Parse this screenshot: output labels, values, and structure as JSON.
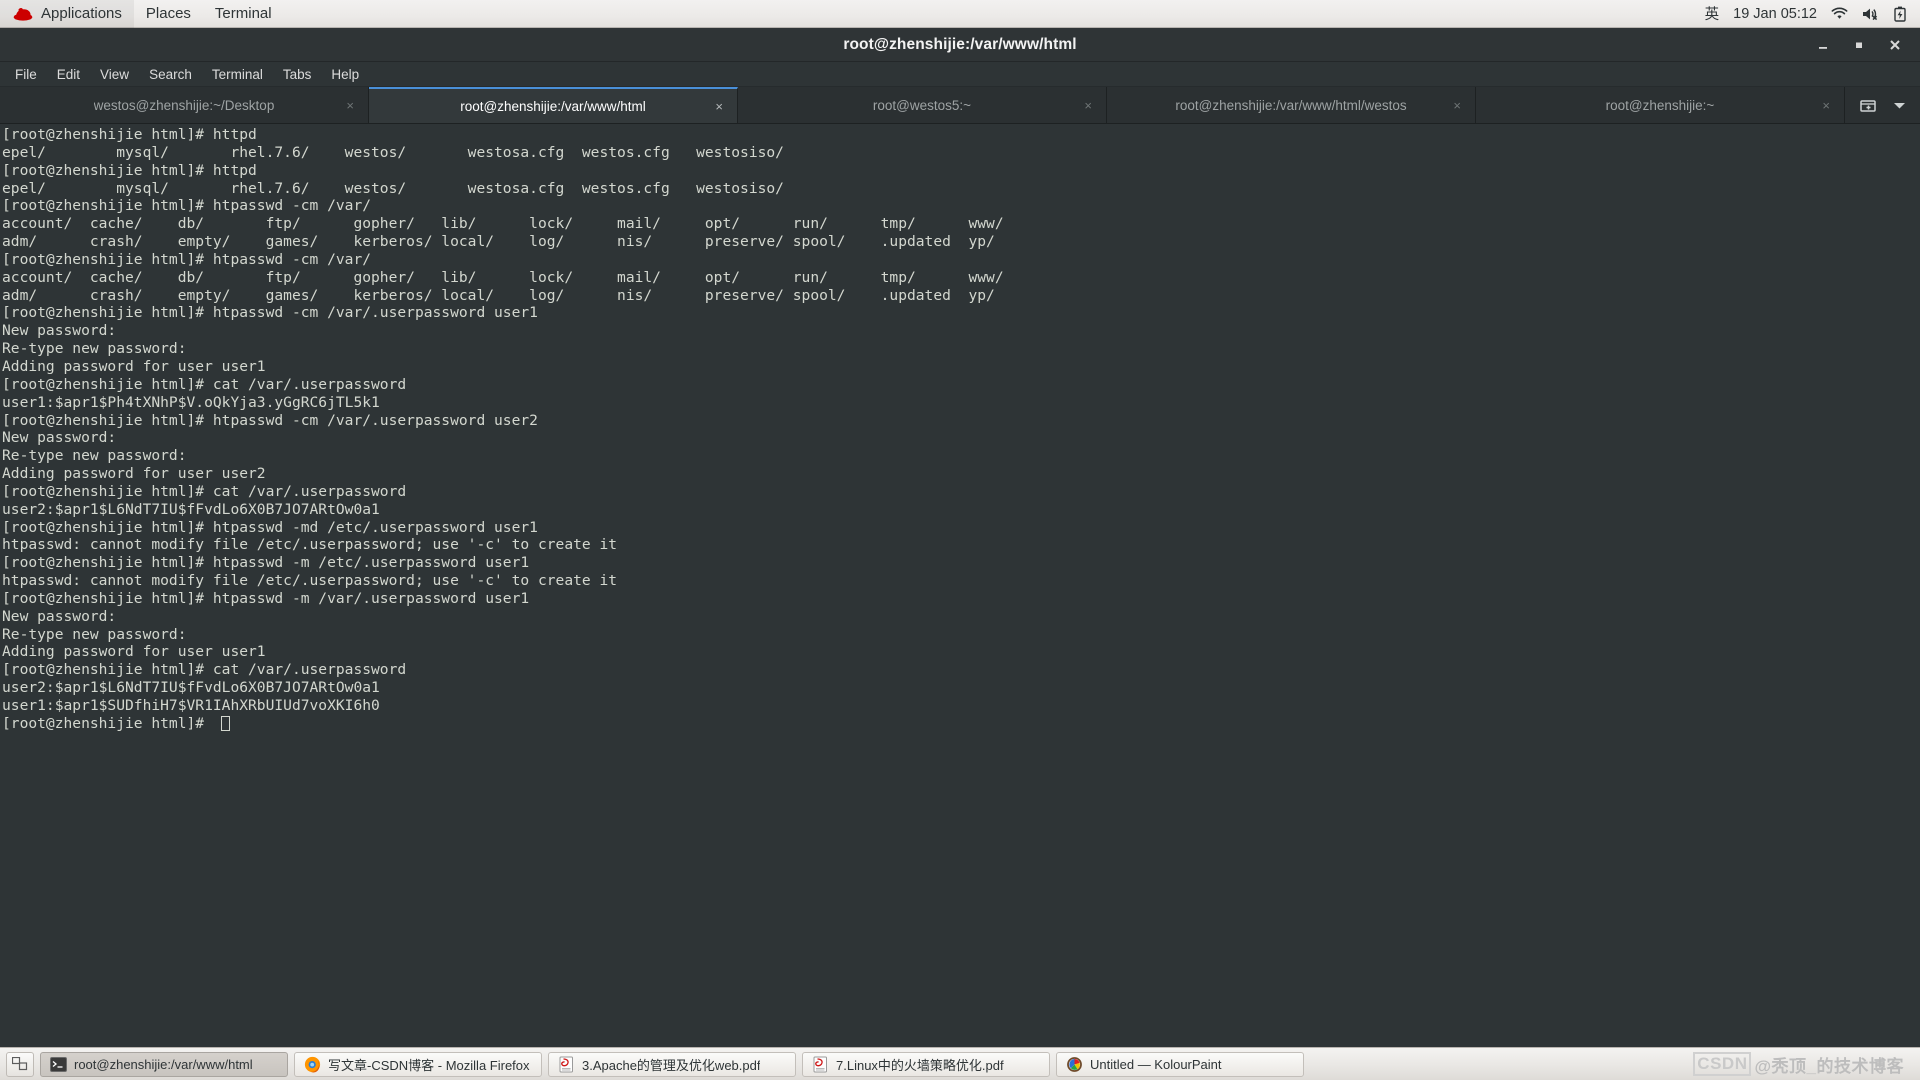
{
  "top_panel": {
    "logo_icon": "redhat-logo-icon",
    "menus": [
      "Applications",
      "Places",
      "Terminal"
    ],
    "input_method": "英",
    "clock": "19 Jan 05:12",
    "tray_icons": [
      "wifi-icon",
      "volume-muted-icon",
      "battery-charging-icon"
    ]
  },
  "window": {
    "title": "root@zhenshijie:/var/www/html",
    "controls": {
      "minimize": "minimize-button",
      "maximize": "maximize-button",
      "close": "close-button"
    }
  },
  "menubar": {
    "items": [
      "File",
      "Edit",
      "View",
      "Search",
      "Terminal",
      "Tabs",
      "Help"
    ]
  },
  "tabs": {
    "items": [
      {
        "label": "westos@zhenshijie:~/Desktop",
        "active": false
      },
      {
        "label": "root@zhenshijie:/var/www/html",
        "active": true
      },
      {
        "label": "root@westos5:~",
        "active": false
      },
      {
        "label": "root@zhenshijie:/var/www/html/westos",
        "active": false
      },
      {
        "label": "root@zhenshijie:~",
        "active": false
      }
    ],
    "close_glyph": "×",
    "new_tab_icon": "new-tab-icon",
    "tab_list_icon": "chevron-down-icon"
  },
  "terminal": {
    "prompt": "[root@zhenshijie html]# ",
    "lines": [
      "[root@zhenshijie html]# httpd",
      "epel/        mysql/       rhel.7.6/    westos/       westosa.cfg  westos.cfg   westosiso/",
      "[root@zhenshijie html]# httpd",
      "epel/        mysql/       rhel.7.6/    westos/       westosa.cfg  westos.cfg   westosiso/",
      "[root@zhenshijie html]# htpasswd -cm /var/",
      "account/  cache/    db/       ftp/      gopher/   lib/      lock/     mail/     opt/      run/      tmp/      www/",
      "adm/      crash/    empty/    games/    kerberos/ local/    log/      nis/      preserve/ spool/    .updated  yp/",
      "[root@zhenshijie html]# htpasswd -cm /var/",
      "account/  cache/    db/       ftp/      gopher/   lib/      lock/     mail/     opt/      run/      tmp/      www/",
      "adm/      crash/    empty/    games/    kerberos/ local/    log/      nis/      preserve/ spool/    .updated  yp/",
      "[root@zhenshijie html]# htpasswd -cm /var/.userpassword user1",
      "New password:",
      "Re-type new password:",
      "Adding password for user user1",
      "[root@zhenshijie html]# cat /var/.userpassword",
      "user1:$apr1$Ph4tXNhP$V.oQkYja3.yGgRC6jTL5k1",
      "[root@zhenshijie html]# htpasswd -cm /var/.userpassword user2",
      "New password:",
      "Re-type new password:",
      "Adding password for user user2",
      "[root@zhenshijie html]# cat /var/.userpassword",
      "user2:$apr1$L6NdT7IU$fFvdLo6X0B7JO7ARtOw0a1",
      "[root@zhenshijie html]# htpasswd -md /etc/.userpassword user1",
      "htpasswd: cannot modify file /etc/.userpassword; use '-c' to create it",
      "[root@zhenshijie html]# htpasswd -m /etc/.userpassword user1",
      "htpasswd: cannot modify file /etc/.userpassword; use '-c' to create it",
      "[root@zhenshijie html]# htpasswd -m /var/.userpassword user1",
      "New password:",
      "Re-type new password:",
      "Adding password for user user1",
      "[root@zhenshijie html]# cat /var/.userpassword",
      "user2:$apr1$L6NdT7IU$fFvdLo6X0B7JO7ARtOw0a1",
      "user1:$apr1$SUDfhiH7$VR1IAhXRbUIUd7voXKI6h0"
    ]
  },
  "taskbar": {
    "show_desktop_icon": "show-desktop-icon",
    "items": [
      {
        "label": "root@zhenshijie:/var/www/html",
        "icon": "terminal-icon",
        "active": true
      },
      {
        "label": "写文章-CSDN博客 - Mozilla Firefox",
        "icon": "firefox-icon",
        "active": false
      },
      {
        "label": "3.Apache的管理及优化web.pdf",
        "icon": "pdf-viewer-icon",
        "active": false
      },
      {
        "label": "7.Linux中的火墙策略优化.pdf",
        "icon": "pdf-viewer-icon",
        "active": false
      },
      {
        "label": "Untitled — KolourPaint",
        "icon": "kolourpaint-icon",
        "active": false
      }
    ],
    "watermark": {
      "brand": "CSDN",
      "author": "@秃顶_的技术博客"
    }
  },
  "colors": {
    "panel_bg": "#eceae8",
    "terminal_bg": "#2e3436",
    "terminal_fg": "#d3d7cf",
    "active_tab_accent": "#4a90d9",
    "redhat_red": "#cc0000"
  }
}
